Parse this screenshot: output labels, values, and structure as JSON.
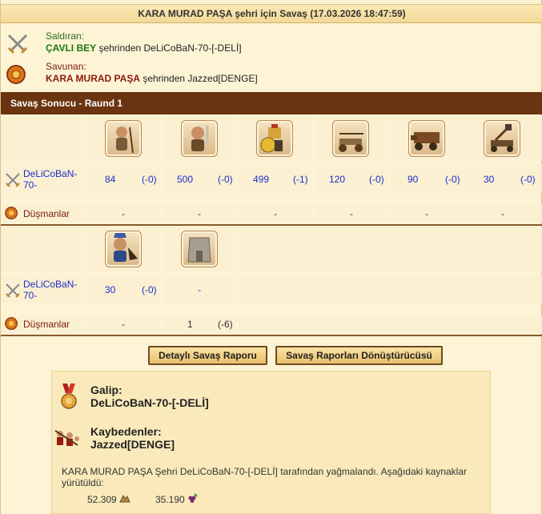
{
  "report": {
    "title": "KARA MURAD PAŞA şehri için Savaş (17.03.2026 18:47:59)",
    "attacker_role": "Saldıran:",
    "attacker_name": "ÇAVLI BEY",
    "attacker_from": " şehrinden DeLiCoBaN-70-[-DELİ]",
    "defender_role": "Savunan:",
    "defender_name": "KARA MURAD PAŞA",
    "defender_from": " şehrinden Jazzed[DENGE]"
  },
  "round": {
    "title": "Savaş Sonucu - Raund 1"
  },
  "group1": {
    "attacker_label": "DeLiCoBaN-70-",
    "enemy_label": "Düşmanlar",
    "units": [
      {
        "icon": "spearman-icon",
        "count": "84",
        "loss": "(-0)",
        "enemy": "-"
      },
      {
        "icon": "swordsman-icon",
        "count": "500",
        "loss": "(-0)",
        "enemy": "-"
      },
      {
        "icon": "hoplite-icon",
        "count": "499",
        "loss": "(-1)",
        "enemy": "-"
      },
      {
        "icon": "ballista-icon",
        "count": "120",
        "loss": "(-0)",
        "enemy": "-"
      },
      {
        "icon": "ram-icon",
        "count": "90",
        "loss": "(-0)",
        "enemy": "-"
      },
      {
        "icon": "catapult-icon",
        "count": "30",
        "loss": "(-0)",
        "enemy": "-"
      }
    ]
  },
  "group2": {
    "attacker_label": "DeLiCoBaN-70-",
    "enemy_label": "Düşmanlar",
    "units": [
      {
        "icon": "commander-icon",
        "count": "30",
        "loss": "(-0)",
        "enemy": "-",
        "enemy_loss": ""
      },
      {
        "icon": "wall-icon",
        "count": "-",
        "loss": "",
        "enemy": "1",
        "enemy_loss": "(-6)"
      }
    ]
  },
  "buttons": {
    "detailed": "Detaylı Savaş Raporu",
    "converter": "Savaş Raporları Dönüştürücüsü"
  },
  "result": {
    "winner_title": "Galip:",
    "winner_name": "DeLiCoBaN-70-[-DELİ]",
    "loser_title": "Kaybedenler:",
    "loser_name": "Jazzed[DENGE]",
    "plunder_text": "KARA MURAD PAŞA Şehri DeLiCoBaN-70-[-DELİ] tarafından yağmalandı. Aşağıdaki kaynaklar yürütüldü:",
    "resource1": "52.309",
    "resource2": "35.190"
  }
}
